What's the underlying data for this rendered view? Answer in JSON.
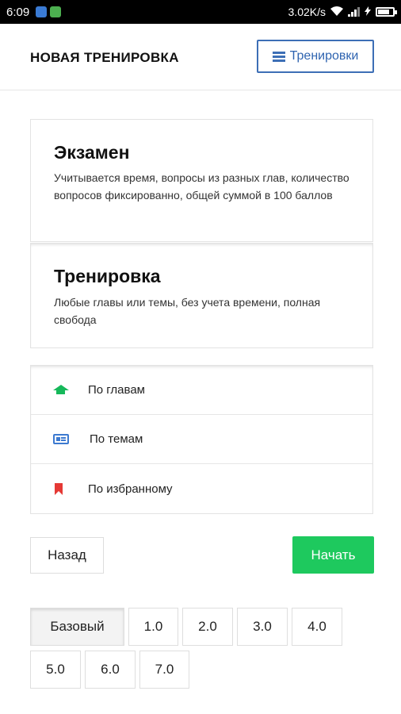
{
  "status_bar": {
    "time": "6:09",
    "network_speed": "3.02K/s",
    "icons": [
      "app-icon-blue",
      "app-icon-green",
      "wifi-icon",
      "signal-icon",
      "charging-icon",
      "battery-icon"
    ]
  },
  "header": {
    "title": "НОВАЯ ТРЕНИРОВКА",
    "trainings_button": {
      "label": "Тренировки",
      "icon": "list-icon"
    }
  },
  "modes": [
    {
      "title": "Экзамен",
      "description": "Учитывается время, вопросы из разных глав, количество вопросов фиксированно, общей суммой в 100 баллов"
    },
    {
      "title": "Тренировка",
      "description": "Любые главы или темы, без учета времени, полная свобода"
    }
  ],
  "options": [
    {
      "label": "По главам",
      "icon": "graduation-cap-icon",
      "color": "#16b85a"
    },
    {
      "label": "По темам",
      "icon": "id-card-icon",
      "color": "#3d7ad0"
    },
    {
      "label": "По избранному",
      "icon": "bookmark-icon",
      "color": "#e53935"
    }
  ],
  "actions": {
    "back_label": "Назад",
    "start_label": "Начать"
  },
  "levels": {
    "selected": "Базовый",
    "items": [
      "Базовый",
      "1.0",
      "2.0",
      "3.0",
      "4.0",
      "5.0",
      "6.0",
      "7.0"
    ]
  },
  "colors": {
    "accent_green": "#1ec95e",
    "accent_blue": "#3d6fb6"
  }
}
